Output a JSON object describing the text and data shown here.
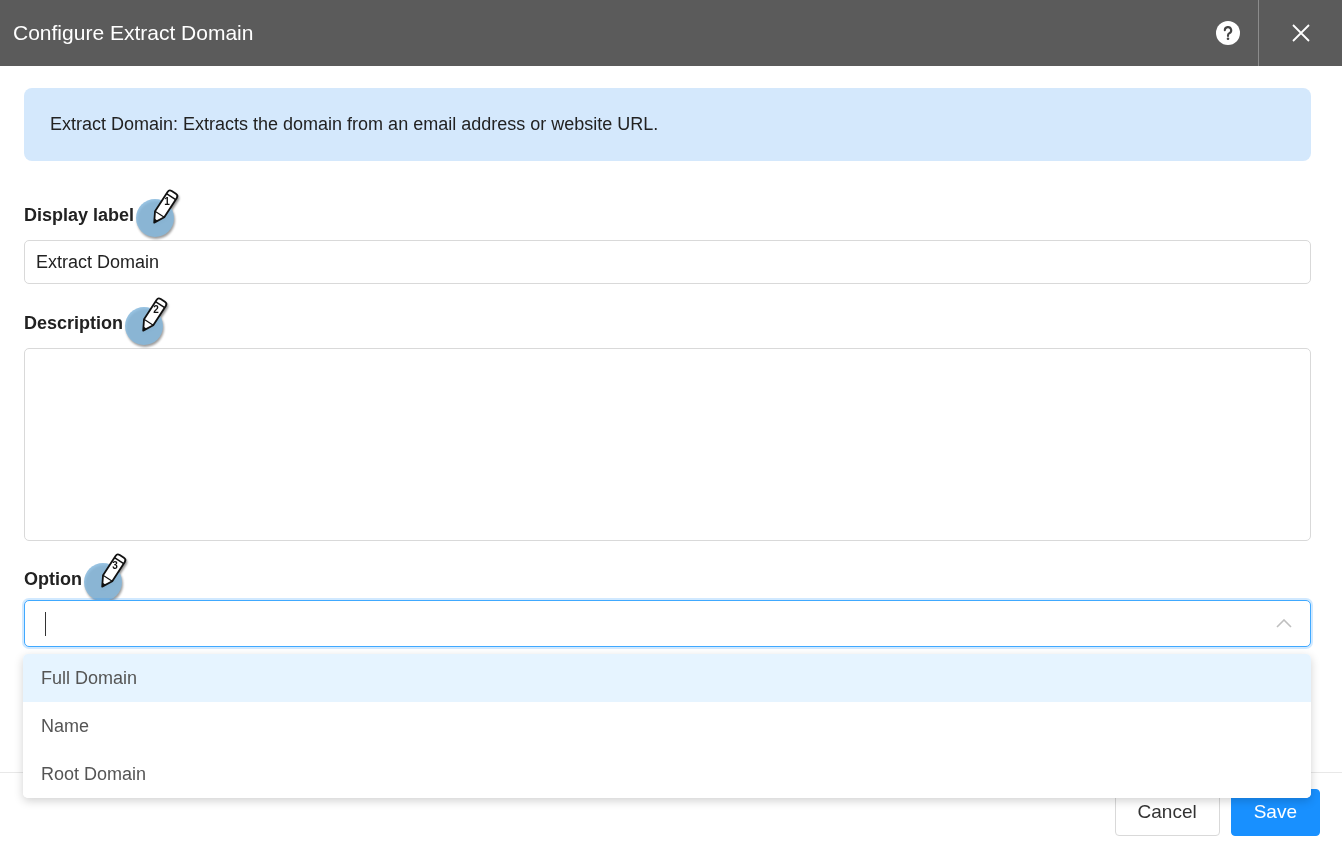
{
  "dialog": {
    "title": "Configure Extract Domain"
  },
  "info_banner": {
    "text": "Extract Domain: Extracts the domain from an email address or website URL."
  },
  "fields": [
    {
      "kind": "text",
      "label": "Display label",
      "marker": "1",
      "value": "Extract Domain"
    },
    {
      "kind": "textarea",
      "label": "Description",
      "marker": "2"
    },
    {
      "kind": "select",
      "label": "Option",
      "marker": "3",
      "focused": true,
      "expanded": true,
      "options": [
        {
          "label": "Full Domain",
          "selected": true
        },
        {
          "label": "Name",
          "selected": false
        },
        {
          "label": "Root Domain",
          "selected": false
        }
      ]
    }
  ],
  "buttons": [
    {
      "label": "Cancel",
      "kind": "secondary"
    },
    {
      "label": "Save",
      "kind": "primary"
    }
  ]
}
